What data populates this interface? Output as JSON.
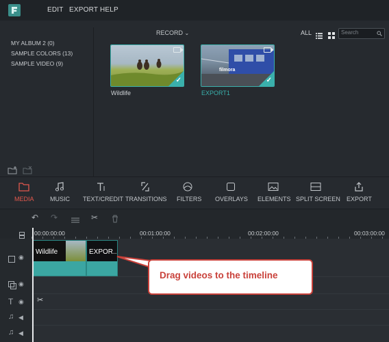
{
  "menu": {
    "edit": "EDIT",
    "export": "EXPORT",
    "help": "HELP"
  },
  "albums": [
    "MY ALBUM 2 (0)",
    "SAMPLE COLORS (13)",
    "SAMPLE VIDEO (9)"
  ],
  "media": {
    "record_label": "RECORD",
    "all_label": "ALL",
    "search_placeholder": "Search",
    "items": [
      {
        "label": "Wildlife",
        "label_color": "#e2584d"
      },
      {
        "label": "EXPORT1",
        "label_color": "#3ab0ac"
      }
    ],
    "thumb_overlay_text": "filmora"
  },
  "tools": [
    "MEDIA",
    "MUSIC",
    "TEXT/CREDIT",
    "TRANSITIONS",
    "FILTERS",
    "OVERLAYS",
    "ELEMENTS",
    "SPLIT SCREEN",
    "EXPORT"
  ],
  "timeline": {
    "timecodes": [
      "00:00:00:00",
      "00:01:00:00",
      "00:02:00:00",
      "00:03:00:00"
    ],
    "clips": [
      "Wildlife",
      "EXPOR..."
    ]
  },
  "callout": {
    "text": "Drag videos to the timeline"
  },
  "colors": {
    "accent": "#3ab0ac",
    "active_tool": "#e2584d",
    "callout_border": "#c9413a"
  }
}
